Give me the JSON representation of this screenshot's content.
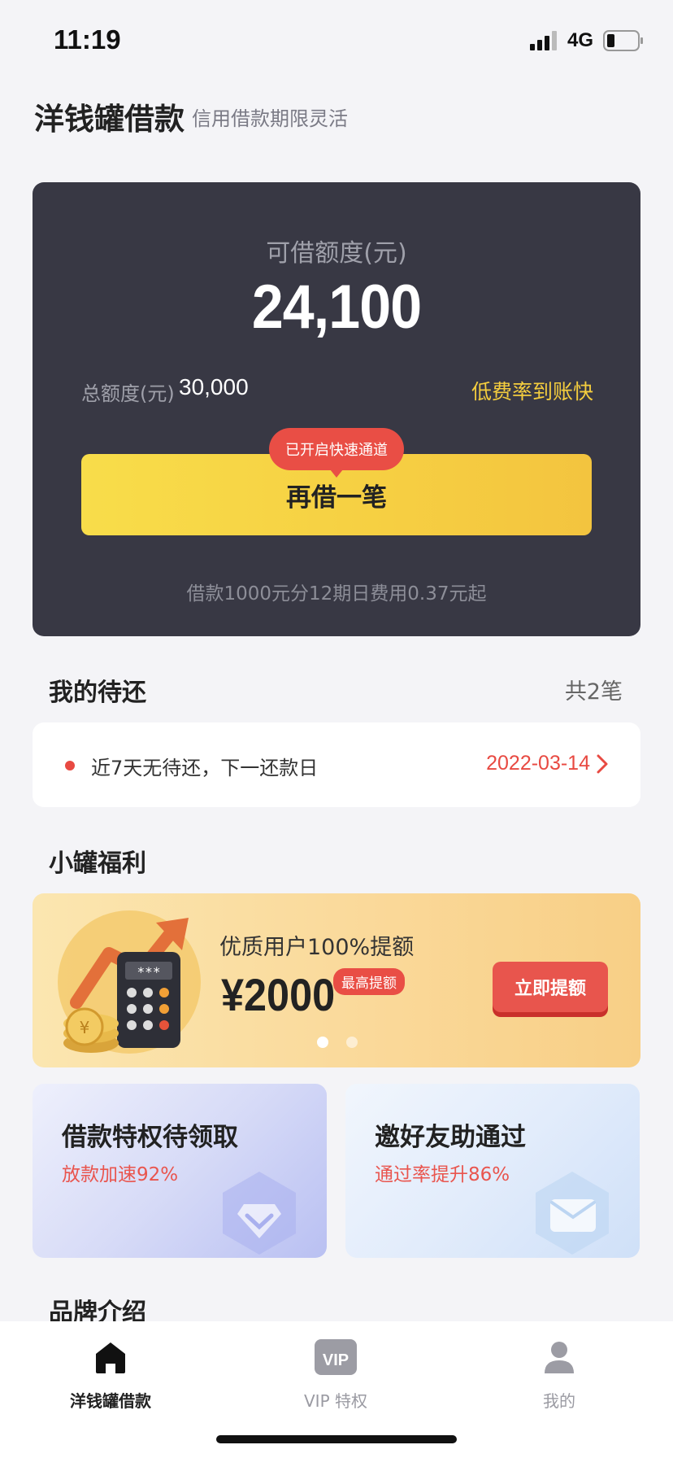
{
  "status": {
    "time": "11:19",
    "network": "4G"
  },
  "header": {
    "title": "洋钱罐借款",
    "subtitle": "信用借款期限灵活"
  },
  "credit": {
    "label": "可借额度(元)",
    "amount": "24,100",
    "total_label": "总额度(元)",
    "total_value": "30,000",
    "feature_tag": "低费率到账快",
    "fast_badge": "已开启快速通道",
    "borrow_button": "再借一笔",
    "fee_note": "借款1000元分12期日费用0.37元起"
  },
  "repayment": {
    "title": "我的待还",
    "count": "共2笔",
    "message": "近7天无待还，下一还款日",
    "next_date": "2022-03-14"
  },
  "welfare": {
    "title": "小罐福利",
    "banner": {
      "headline": "优质用户100%提额",
      "amount": "¥2000",
      "badge": "最高提额",
      "button": "立即提额",
      "dots_total": 2,
      "dot_active": 1
    },
    "perks": [
      {
        "title": "借款特权待领取",
        "subtitle": "放款加速92%",
        "icon": "diamond-icon"
      },
      {
        "title": "邀好友助通过",
        "subtitle": "通过率提升86%",
        "icon": "envelope-icon"
      }
    ]
  },
  "brand": {
    "title": "品牌介绍"
  },
  "tabs": [
    {
      "label": "洋钱罐借款",
      "icon": "home-icon",
      "active": true
    },
    {
      "label": "VIP 特权",
      "icon": "vip-icon",
      "active": false
    },
    {
      "label": "我的",
      "icon": "user-icon",
      "active": false
    }
  ],
  "colors": {
    "card_bg": "#383844",
    "accent_yellow": "#f6cf42",
    "accent_red": "#e94e45",
    "page_bg": "#f4f4f7"
  }
}
